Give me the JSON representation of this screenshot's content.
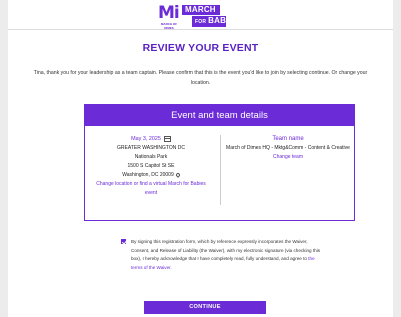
{
  "logo": {
    "mark": "Mi",
    "sub_text": "MARCH OF DIMES",
    "tag_line1": "MARCH",
    "tag_for": "FOR",
    "tag_line2": "BABIES"
  },
  "page_title": "REVIEW YOUR EVENT",
  "intro_text": "Tina, thank you for your leadership as a team captain. Please confirm that this is the event you'd like to join by selecting continue. Or change your location.",
  "details": {
    "header": "Event and team details",
    "event": {
      "date": "May 3, 2025",
      "location_name": "GREATER WASHINGTON DC",
      "venue": "Nationals Park",
      "street": "1500 S Capitol St SE",
      "city": "Washington, DC 20009",
      "change_link": "Change location or find a virtual March for Babies event"
    },
    "team": {
      "label": "Team name",
      "name": "March of Dimes HQ - Mktg&Comm - Content & Creative",
      "change_link": "Change team"
    }
  },
  "consent": {
    "text": "By signing this registration form, which by reference expressly incorporates the Waiver, Consent, and Release of Liability (the Waiver), with my electronic signature (via checking this box), I hereby acknowledge that I have completely read, fully understand, and agree to ",
    "link": "the terms of the Waiver.",
    "checked": true
  },
  "continue_label": "CONTINUE",
  "colors": {
    "brand_purple": "#6b2bd6",
    "page_bg": "#ececec"
  }
}
